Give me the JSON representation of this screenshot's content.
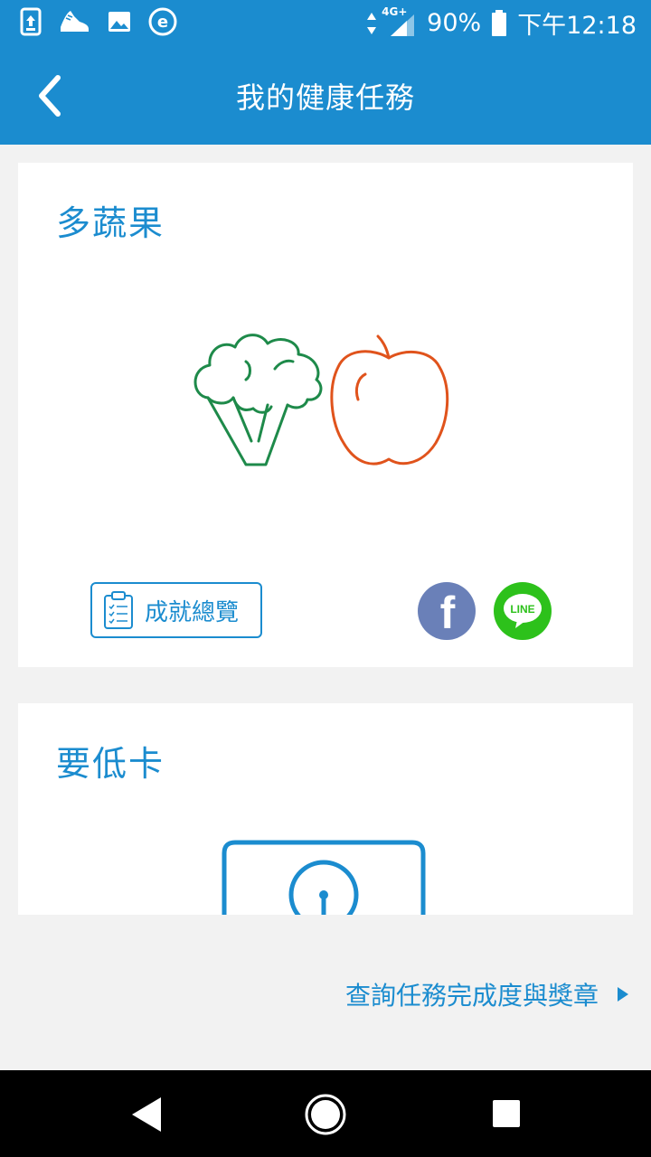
{
  "status_bar": {
    "network": "4G+",
    "battery": "90%",
    "time": "下午12:18",
    "icons": [
      "upload-icon",
      "sneaker-icon",
      "image-icon",
      "e-app-icon",
      "data-arrows-icon",
      "signal-icon",
      "battery-icon"
    ]
  },
  "app_bar": {
    "title": "我的健康任務",
    "back_icon": "chevron-left-icon"
  },
  "cards": [
    {
      "title": "多蔬果",
      "illustration": [
        "broccoli-icon",
        "apple-icon"
      ],
      "summary_button_label": "成就總覽",
      "share": {
        "facebook_label": "f",
        "line_label": "LINE"
      }
    },
    {
      "title": "要低卡",
      "illustration": [
        "scale-icon"
      ]
    }
  ],
  "footer_link": {
    "label": "查詢任務完成度與獎章",
    "icon": "play-arrow-icon"
  },
  "colors": {
    "primary": "#1b8ccf",
    "background": "#f2f2f2",
    "broccoli": "#1e8a4a",
    "apple": "#e0531c",
    "facebook": "#6a80b8",
    "line": "#2dc11b"
  },
  "nav_bar": [
    "back-triangle-icon",
    "home-circle-icon",
    "recents-square-icon"
  ]
}
